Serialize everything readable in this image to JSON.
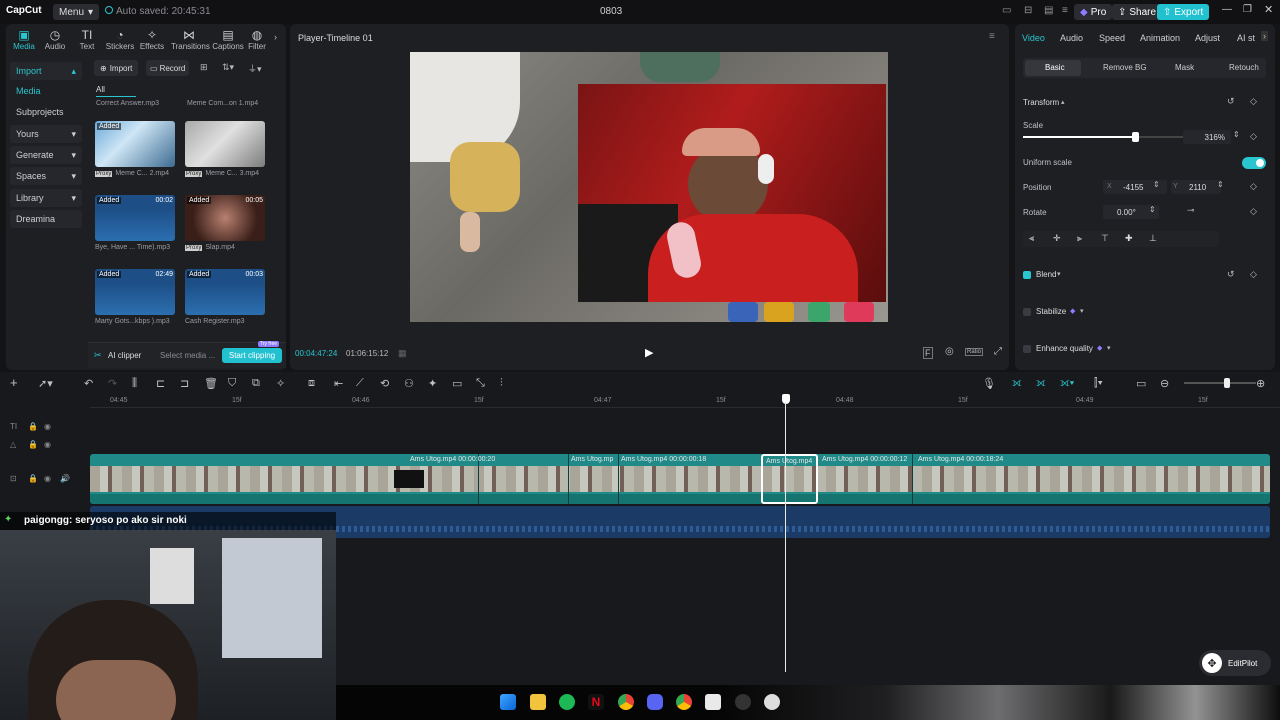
{
  "titlebar": {
    "logo": "CapCut",
    "menu": "Menu",
    "autosave": "Auto saved: 20:45:31",
    "project": "0803",
    "pro": "Pro",
    "share": "Share",
    "export": "Export"
  },
  "toptabs": [
    {
      "label": "Media",
      "icon": "film-icon"
    },
    {
      "label": "Audio",
      "icon": "audio-icon"
    },
    {
      "label": "Text",
      "icon": "text-icon"
    },
    {
      "label": "Stickers",
      "icon": "sticker-icon"
    },
    {
      "label": "Effects",
      "icon": "effects-icon"
    },
    {
      "label": "Transitions",
      "icon": "transition-icon"
    },
    {
      "label": "Captions",
      "icon": "captions-icon"
    },
    {
      "label": "Filter",
      "icon": "filter-icon"
    }
  ],
  "sidebar": {
    "items": [
      {
        "label": "Import"
      },
      {
        "label": "Media"
      },
      {
        "label": "Subprojects"
      },
      {
        "label": "Yours"
      },
      {
        "label": "Generate"
      },
      {
        "label": "Spaces"
      },
      {
        "label": "Library"
      },
      {
        "label": "Dreamina"
      }
    ]
  },
  "media": {
    "import": "Import",
    "record": "Record",
    "filter_all": "All",
    "top_files": [
      "Correct Answer.mp3",
      "Meme Com...on 1.mp4"
    ],
    "items": [
      {
        "added": "Added",
        "duration": "",
        "name": "Meme C... 2.mp4",
        "proxy": "Proxy"
      },
      {
        "added": "",
        "duration": "",
        "name": "Meme C... 3.mp4",
        "proxy": "Proxy"
      },
      {
        "added": "Added",
        "duration": "00:02",
        "name": "Bye, Have ... Time).mp3",
        "proxy": ""
      },
      {
        "added": "Added",
        "duration": "00:05",
        "name": "Slap.mp4",
        "proxy": "Proxy"
      },
      {
        "added": "Added",
        "duration": "02:49",
        "name": "Marty Gots...kbps ).mp3",
        "proxy": ""
      },
      {
        "added": "Added",
        "duration": "00:03",
        "name": "Cash Register.mp3",
        "proxy": ""
      }
    ],
    "ai_clipper": "AI clipper",
    "select_media": "Select media ...",
    "start_clipping": "Start clipping",
    "try_free": "Try free"
  },
  "player": {
    "title": "Player-Timeline 01",
    "current_time": "00:04:47:24",
    "total_time": "01:06:15:12",
    "ratio": "Ratio"
  },
  "inspector": {
    "tabs": [
      "Video",
      "Audio",
      "Speed",
      "Animation",
      "Adjust",
      "AI st"
    ],
    "subtabs": [
      "Basic",
      "Remove BG",
      "Mask",
      "Retouch"
    ],
    "transform": "Transform",
    "scale_label": "Scale",
    "scale_value": "316%",
    "scale_fraction": 0.7,
    "uniform_scale": "Uniform scale",
    "position_label": "Position",
    "x_label": "X",
    "x_value": "-4155",
    "y_label": "Y",
    "y_value": "2110",
    "rotate_label": "Rotate",
    "rotate_value": "0.00°",
    "blend": "Blend",
    "stabilize": "Stabilize",
    "enhance_quality": "Enhance quality"
  },
  "timeline": {
    "ruler": [
      "04:45",
      "15f",
      "04:46",
      "15f",
      "04:47",
      "15f",
      "04:48",
      "15f",
      "04:49",
      "15f"
    ],
    "clips": [
      {
        "label": "Ams Utog.mp4  00:00:00:20"
      },
      {
        "label": "Ams Utog.mp"
      },
      {
        "label": "Ams Utog.mp4  00:00:00:18"
      },
      {
        "label": "Ams Utog.mp4"
      },
      {
        "label": "Ams Utog.mp4  00:00:00:12"
      },
      {
        "label": "Ams Utog.mp4  00:00:18:24"
      }
    ]
  },
  "overlay": {
    "chat": "paigongg: seryoso po ako sir noki",
    "editpilot": "EditPilot"
  },
  "colors": {
    "accent": "#29c6cf",
    "video_track": "#1f8a87",
    "audio_track": "#1b3a66",
    "export_bg": "#22c1d0"
  }
}
